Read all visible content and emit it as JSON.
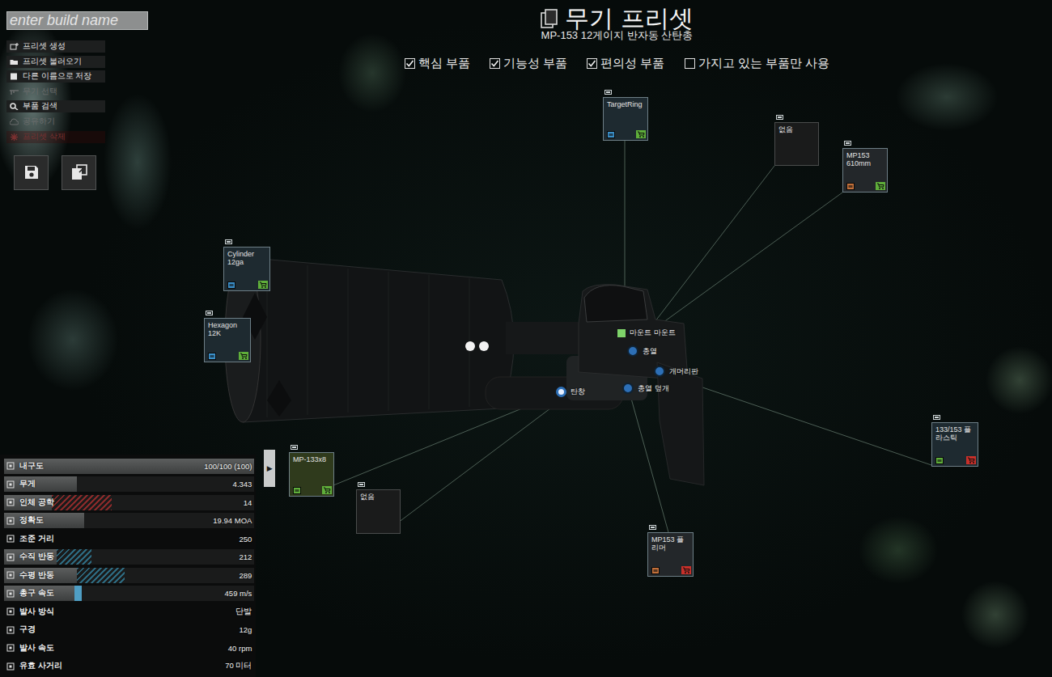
{
  "build_name": {
    "placeholder": "enter build name"
  },
  "menu": [
    {
      "label": "프리셋 생성",
      "disabled": false,
      "danger": false
    },
    {
      "label": "프리셋 불러오기",
      "disabled": false,
      "danger": false
    },
    {
      "label": "다른 이름으로 저장",
      "disabled": false,
      "danger": false
    },
    {
      "label": "무기 선택",
      "disabled": true,
      "danger": false
    },
    {
      "label": "부품 검색",
      "disabled": false,
      "danger": false
    },
    {
      "label": "공유하기",
      "disabled": true,
      "danger": false
    },
    {
      "label": "프리셋 삭제",
      "disabled": true,
      "danger": true
    }
  ],
  "header": {
    "title": "무기 프리셋",
    "subtitle": "MP-153 12게이지 반자동 산탄총"
  },
  "filters": [
    {
      "label": "핵심 부품",
      "checked": true
    },
    {
      "label": "기능성 부품",
      "checked": true
    },
    {
      "label": "편의성 부품",
      "checked": true
    },
    {
      "label": "가지고 있는 부품만 사용",
      "checked": false
    }
  ],
  "slots": [
    {
      "label": "마운트 마운트",
      "kind": "mount",
      "selected": false
    },
    {
      "label": "총열",
      "kind": "slot",
      "selected": false
    },
    {
      "label": "개머리판",
      "kind": "slot",
      "selected": false
    },
    {
      "label": "총열 덮개",
      "kind": "slot",
      "selected": false
    },
    {
      "label": "탄창",
      "kind": "slot",
      "selected": true
    }
  ],
  "parts": [
    {
      "lines": [
        "TargetRing"
      ],
      "kind": "part",
      "tint": "#1e2a30",
      "source_color": "#3a8fc8",
      "cart_color": "#5fae3a"
    },
    {
      "lines": [
        "없음"
      ],
      "kind": "empty"
    },
    {
      "lines": [
        "MP153",
        "610mm"
      ],
      "kind": "part",
      "tint": "#23272a",
      "source_color": "#c2703a",
      "cart_color": "#5fae3a"
    },
    {
      "lines": [
        "Cylinder",
        "12ga"
      ],
      "kind": "part",
      "tint": "#1e2a30",
      "source_color": "#3a8fc8",
      "cart_color": "#5fae3a"
    },
    {
      "lines": [
        "Hexagon",
        "12K"
      ],
      "kind": "part",
      "tint": "#1e2a30",
      "source_color": "#3a8fc8",
      "cart_color": "#5fae3a"
    },
    {
      "lines": [
        "133/153 플",
        "라스틱"
      ],
      "kind": "part",
      "tint": "#1e2a30",
      "source_color": "#5fae3a",
      "cart_color": "#c8302a"
    },
    {
      "lines": [
        "MP-133x8"
      ],
      "kind": "part",
      "tint": "#2f3a1c",
      "source_color": "#5fae3a",
      "cart_color": "#5fae3a"
    },
    {
      "lines": [
        "없음"
      ],
      "kind": "empty"
    },
    {
      "lines": [
        "MP153 플",
        "리머"
      ],
      "kind": "part",
      "tint": "#23272a",
      "source_color": "#c2703a",
      "cart_color": "#c8302a"
    }
  ],
  "stats": {
    "toggle": "▶",
    "rows": [
      {
        "label": "내구도",
        "value": "100/100 (100)",
        "kind": "bar",
        "level": 1.0
      },
      {
        "label": "무게",
        "value": "4.343",
        "kind": "bar",
        "level": 0.29
      },
      {
        "label": "인체 공학",
        "value": "14",
        "kind": "bar",
        "level": 0.19,
        "mod_level": 0.43,
        "mod_style": "hatch",
        "mod_color": "#8a2a2a"
      },
      {
        "label": "정확도",
        "value": "19.94 MOA",
        "kind": "bar",
        "level": 0.32
      },
      {
        "label": "조준 거리",
        "value": "250",
        "kind": "text"
      },
      {
        "label": "수직 반동",
        "value": "212",
        "kind": "bar",
        "level": 0.21,
        "mod_level": 0.35,
        "mod_style": "hatch",
        "mod_color": "#2d6a80"
      },
      {
        "label": "수평 반동",
        "value": "289",
        "kind": "bar",
        "level": 0.29,
        "mod_level": 0.48,
        "mod_style": "hatch",
        "mod_color": "#2d6a80"
      },
      {
        "label": "총구 속도",
        "value": "459 m/s",
        "kind": "bar",
        "level": 0.28,
        "mod_level": 0.31,
        "mod_style": "solid",
        "mod_color": "#4f9ec4"
      },
      {
        "label": "발사 방식",
        "value": "단발",
        "kind": "text"
      },
      {
        "label": "구경",
        "value": "12g",
        "kind": "text"
      },
      {
        "label": "발사 속도",
        "value": "40 rpm",
        "kind": "text"
      },
      {
        "label": "유효 사거리",
        "value": "70 미터",
        "kind": "text"
      }
    ]
  }
}
